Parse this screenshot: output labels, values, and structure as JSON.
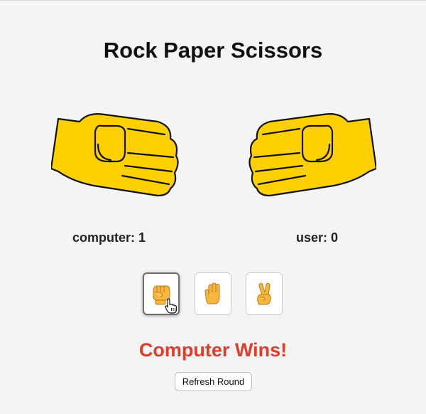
{
  "page": {
    "title": "Rock Paper Scissors"
  },
  "hands": {
    "computer": {
      "icon": "rock-fist-icon"
    },
    "user": {
      "icon": "rock-fist-icon"
    }
  },
  "scores": {
    "computer_text": "computer: 1",
    "user_text": "user: 0"
  },
  "choices": [
    {
      "name": "rock",
      "icon": "raised-fist-emoji-icon",
      "selected": true
    },
    {
      "name": "paper",
      "icon": "raised-hand-emoji-icon",
      "selected": false
    },
    {
      "name": "scissors",
      "icon": "victory-hand-emoji-icon",
      "selected": false
    }
  ],
  "result": {
    "text": "Computer Wins!",
    "color": "#e03c2c"
  },
  "actions": {
    "refresh_label": "Refresh Round"
  },
  "colors": {
    "hand_fill": "#ffd000",
    "hand_outline": "#111111",
    "background": "#f4f4f4"
  }
}
